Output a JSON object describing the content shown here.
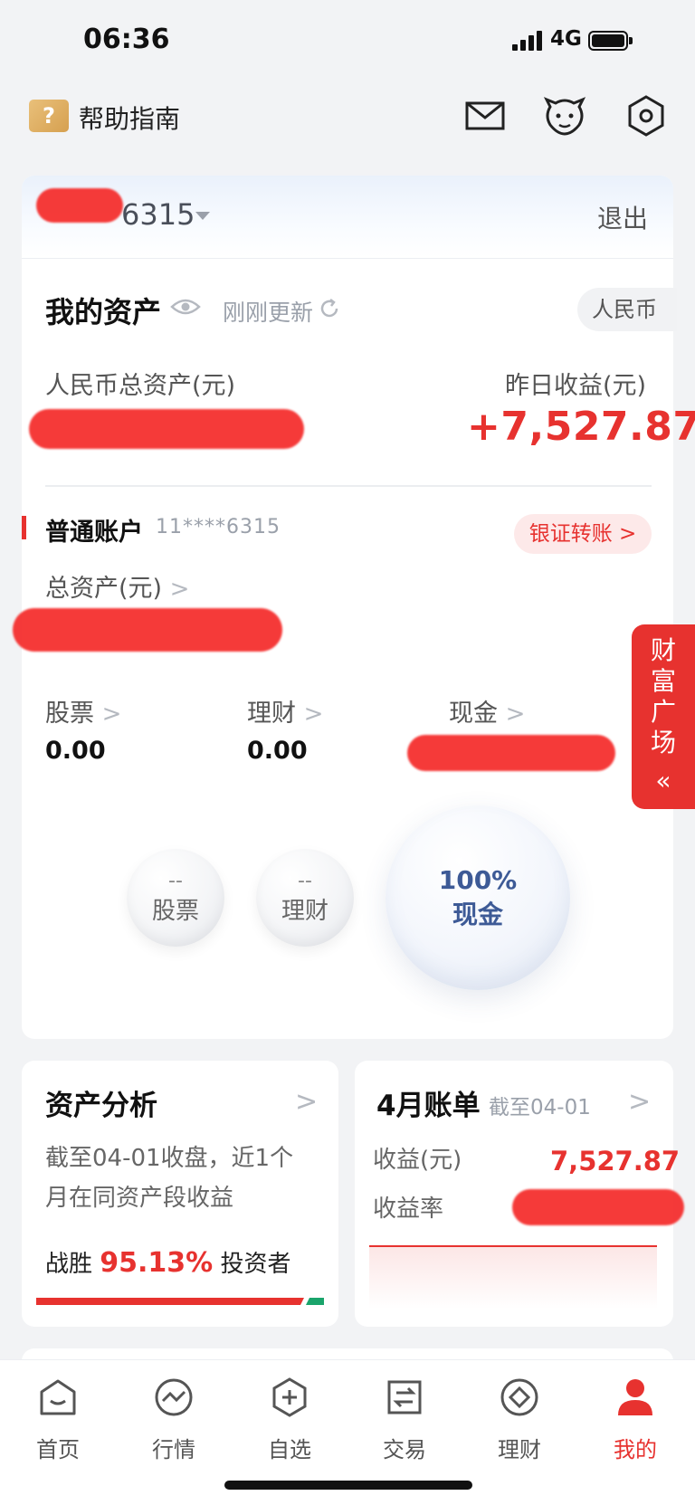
{
  "status_bar": {
    "time": "06:36",
    "network": "4G"
  },
  "header": {
    "help_label": "帮助指南",
    "help_glyph": "?",
    "icons": [
      "mail-icon",
      "mascot-icon",
      "settings-icon"
    ]
  },
  "account_bar": {
    "account_suffix": "6315",
    "logout": "退出"
  },
  "assets": {
    "title": "我的资产",
    "updated": "刚刚更新",
    "currency": "人民币",
    "total_label": "人民币总资产(元)",
    "yesterday_label": "昨日收益(元)",
    "yesterday_value": "+7,527.87"
  },
  "account": {
    "type": "普通账户",
    "masked_number": "11****6315",
    "transfer_button": "银证转账 >",
    "total_label": "总资产(元)",
    "breakdown": [
      {
        "label": "股票",
        "value": "0.00"
      },
      {
        "label": "理财",
        "value": "0.00"
      },
      {
        "label": "现金",
        "value": ""
      }
    ],
    "bubbles": [
      {
        "pct": "--",
        "name": "股票"
      },
      {
        "pct": "--",
        "name": "理财"
      },
      {
        "pct": "100%",
        "name": "现金"
      }
    ]
  },
  "side_tab": {
    "chars": [
      "财",
      "富",
      "广",
      "场"
    ],
    "arrows": "«"
  },
  "analysis": {
    "title": "资产分析",
    "text_line1": "截至04-01收盘，近1个",
    "text_line2": "月在同资产段收益",
    "win_prefix": "战胜",
    "win_pct": "95.13%",
    "win_suffix": "投资者"
  },
  "bill": {
    "title": "4月账单",
    "subtitle": "截至04-01",
    "profit_label": "收益(元)",
    "profit_value": "7,527.87",
    "rate_label": "收益率"
  },
  "tabs": [
    {
      "label": "首页"
    },
    {
      "label": "行情"
    },
    {
      "label": "自选"
    },
    {
      "label": "交易"
    },
    {
      "label": "理财"
    },
    {
      "label": "我的"
    }
  ],
  "colors": {
    "accent": "#e7322f",
    "bubble_text": "#3d5a96"
  }
}
